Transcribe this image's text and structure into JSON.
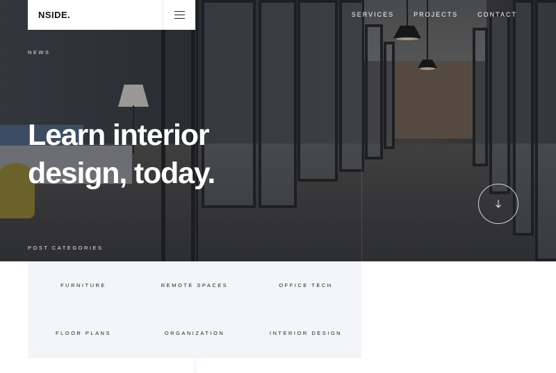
{
  "header": {
    "logo": "NSIDE.",
    "menu_icon": "hamburger-menu-icon"
  },
  "nav": {
    "items": [
      {
        "label": "SERVICES"
      },
      {
        "label": "PROJECTS"
      },
      {
        "label": "CONTACT"
      }
    ]
  },
  "hero": {
    "eyebrow": "NEWS",
    "headline": "Learn interior design, today.",
    "scroll_icon": "arrow-down-icon"
  },
  "categories": {
    "heading": "POST CATEGORIES",
    "items": [
      {
        "label": "FURNITURE"
      },
      {
        "label": "REMOTE SPACES"
      },
      {
        "label": "OFFICE TECH"
      },
      {
        "label": "FLOOR PLANS"
      },
      {
        "label": "ORGANIZATION"
      },
      {
        "label": "INTERIOR DESIGN"
      }
    ]
  },
  "colors": {
    "category_panel_bg": "#f3f5f9",
    "hero_overlay": "#2a2d35",
    "text_light": "#ffffff",
    "text_dark": "#111111"
  }
}
